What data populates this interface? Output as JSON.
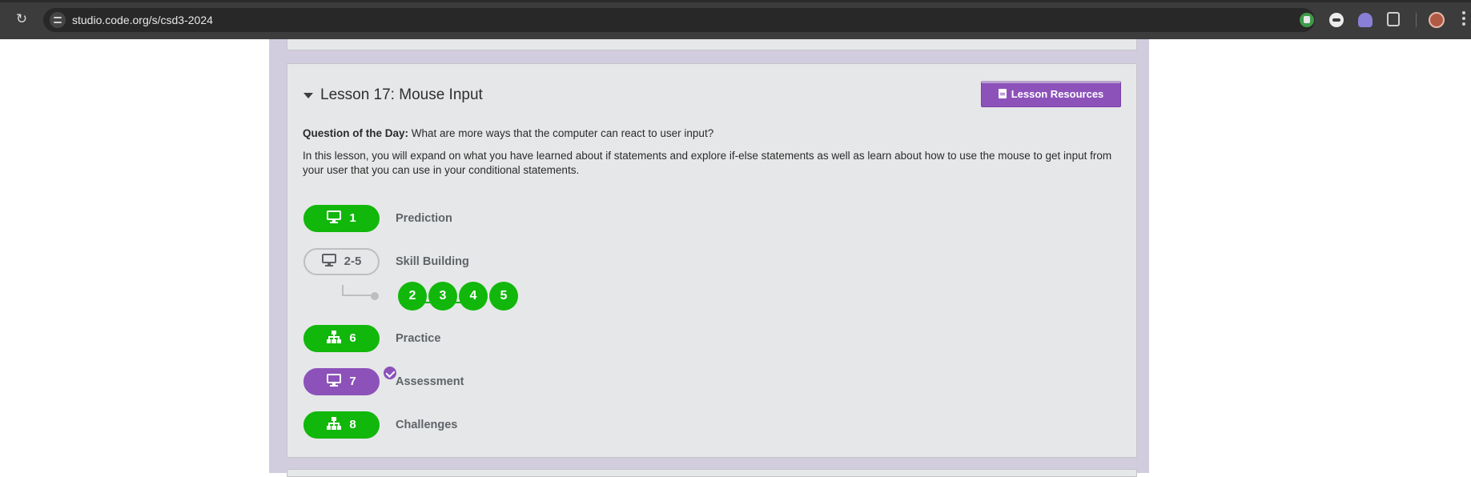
{
  "browser": {
    "url": "studio.code.org/s/csd3-2024"
  },
  "lesson": {
    "title": "Lesson 17: Mouse Input",
    "resources_button": "Lesson Resources",
    "qotd_label": "Question of the Day:",
    "qotd_text": " What are more ways that the computer can react to user input?",
    "description": "In this lesson, you will expand on what you have learned about if statements and explore if-else statements as well as learn about how to use the mouse to get input from your user that you can use in your conditional statements.",
    "activities": [
      {
        "number": "1",
        "label": "Prediction",
        "icon": "monitor-icon",
        "status": "complete"
      },
      {
        "number": "2-5",
        "label": "Skill Building",
        "icon": "monitor-icon",
        "status": "outline"
      },
      {
        "number": "6",
        "label": "Practice",
        "icon": "hierarchy-icon",
        "status": "complete"
      },
      {
        "number": "7",
        "label": "Assessment",
        "icon": "monitor-icon",
        "status": "assessment-submitted"
      },
      {
        "number": "8",
        "label": "Challenges",
        "icon": "hierarchy-icon",
        "status": "complete"
      }
    ],
    "sublevels": [
      "2",
      "3",
      "4",
      "5"
    ]
  },
  "colors": {
    "complete": "#11b70b",
    "assessment": "#8c52ba",
    "page_background": "#d2ccdf",
    "card_background": "#e6e7e8"
  }
}
